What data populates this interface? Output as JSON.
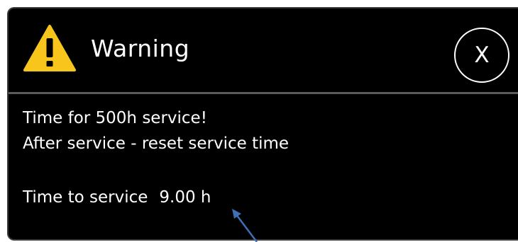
{
  "dialog": {
    "title": "Warning",
    "close_label": "X",
    "message_line1": "Time for 500h service!",
    "message_line2": "After service - reset service time",
    "time_label": "Time to service",
    "time_value": "9.00 h"
  },
  "icons": {
    "warning": "warning-triangle-icon",
    "pointer": "arrow-icon"
  },
  "colors": {
    "background": "#000000",
    "text": "#ffffff",
    "warning_yellow": "#f7c51b",
    "arrow_blue": "#3f6fb5"
  }
}
